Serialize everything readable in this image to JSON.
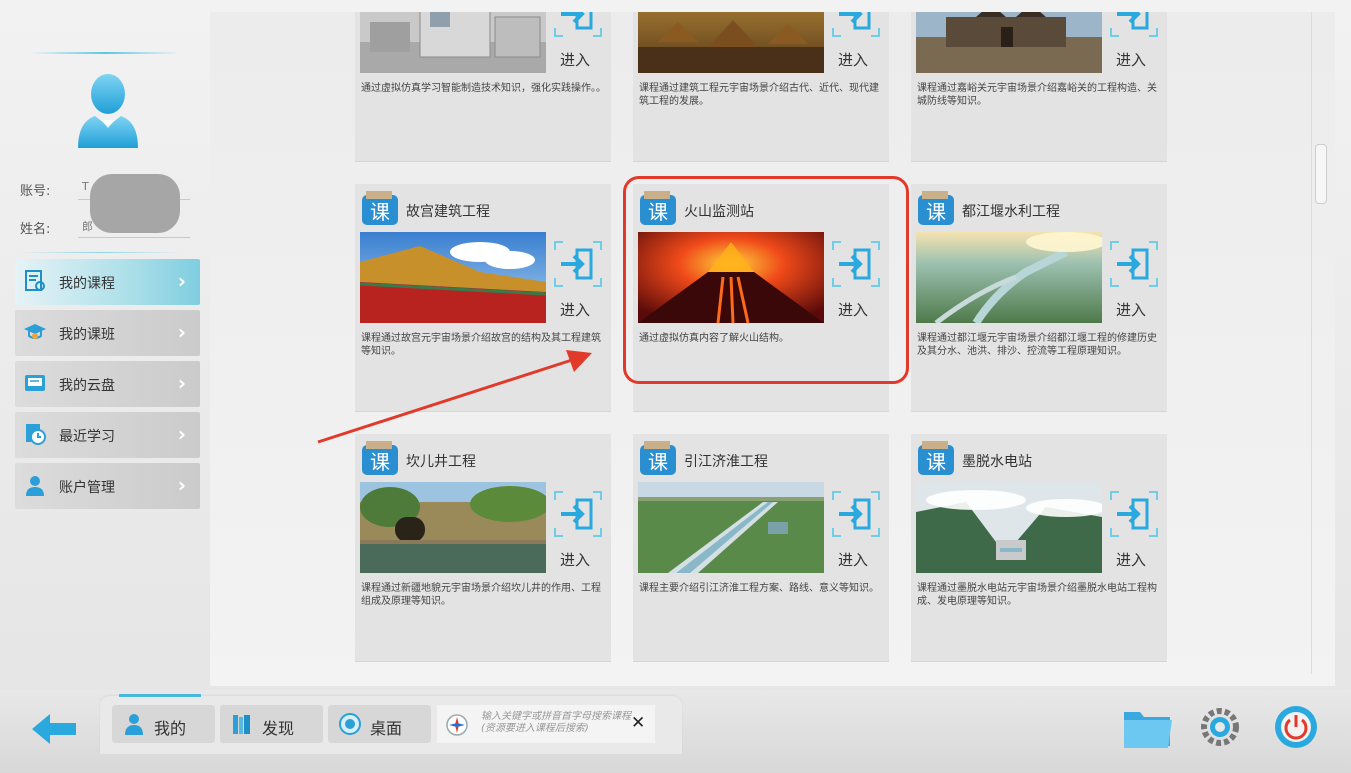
{
  "sidebar": {
    "account_label": "账号:",
    "account_value": "T",
    "name_label": "姓名:",
    "name_value": "郎",
    "menu": [
      {
        "label": "我的课程",
        "icon": "course-document-icon",
        "active": true
      },
      {
        "label": "我的课班",
        "icon": "graduation-cap-icon",
        "active": false
      },
      {
        "label": "我的云盘",
        "icon": "cloud-disk-icon",
        "active": false
      },
      {
        "label": "最近学习",
        "icon": "recent-clock-icon",
        "active": false
      },
      {
        "label": "账户管理",
        "icon": "user-account-icon",
        "active": false
      }
    ]
  },
  "courses": {
    "enter_label": "进入",
    "items": [
      {
        "title": "",
        "desc": "通过虚拟仿真学习智能制造技术知识，强化实践操作。。",
        "theme": "factory"
      },
      {
        "title": "",
        "desc": "课程通过建筑工程元宇宙场景介绍古代、近代、现代建筑工程的发展。",
        "theme": "ancient-village"
      },
      {
        "title": "",
        "desc": "课程通过嘉峪关元宇宙场景介绍嘉峪关的工程构造、关城防线等知识。",
        "theme": "fortress"
      },
      {
        "title": "故宫建筑工程",
        "desc": "课程通过故宫元宇宙场景介绍故宫的结构及其工程建筑等知识。",
        "theme": "palace"
      },
      {
        "title": "火山监测站",
        "desc": "通过虚拟仿真内容了解火山结构。",
        "theme": "volcano"
      },
      {
        "title": "都江堰水利工程",
        "desc": "课程通过都江堰元宇宙场景介绍都江堰工程的修建历史及其分水、池洪、排沙、控流等工程原理知识。",
        "theme": "river-delta"
      },
      {
        "title": "坎儿井工程",
        "desc": "课程通过新疆地貌元宇宙场景介绍坎儿井的作用、工程组成及原理等知识。",
        "theme": "karez"
      },
      {
        "title": "引江济淮工程",
        "desc": "课程主要介绍引江济淮工程方案、路线、意义等知识。",
        "theme": "canal"
      },
      {
        "title": "墨脱水电站",
        "desc": "课程通过墨脱水电站元宇宙场景介绍墨脱水电站工程构成、发电原理等知识。",
        "theme": "dam"
      }
    ]
  },
  "taskbar": {
    "tabs": [
      {
        "label": "我的",
        "icon": "user-icon"
      },
      {
        "label": "发现",
        "icon": "books-icon"
      },
      {
        "label": "桌面",
        "icon": "desktop-globe-icon"
      }
    ],
    "search_placeholder": "输入关键字或拼音首字母搜索课程(资源要进入课程后搜索)",
    "close_symbol": "✕"
  },
  "colors": {
    "accent": "#4ab8df",
    "active_menu": "#aee0ea",
    "highlight": "#e23a2a",
    "card_bg": "#e3e3e3"
  }
}
